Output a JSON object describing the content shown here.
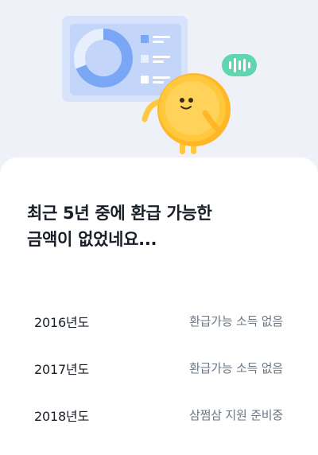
{
  "result": {
    "title_lines": [
      "최근 5년 중에 환급 가능한",
      "금액이 없었네요..."
    ]
  },
  "years": [
    {
      "year": "2016년도",
      "status": "환급가능 소득 없음"
    },
    {
      "year": "2017년도",
      "status": "환급가능 소득 없음"
    },
    {
      "year": "2018년도",
      "status": "삼쩜삼 지원 준비중"
    }
  ],
  "colors": {
    "background": "#eef1f8",
    "card": "#ffffff",
    "coin": "#ffc83d",
    "chart_blue": "#7aa7f5",
    "badge_green": "#5fd6b0",
    "title_text": "#191f28",
    "status_text": "#6b7684"
  },
  "icons": [
    "report-card-illustration",
    "coin-character",
    "sound-bars-icon"
  ]
}
